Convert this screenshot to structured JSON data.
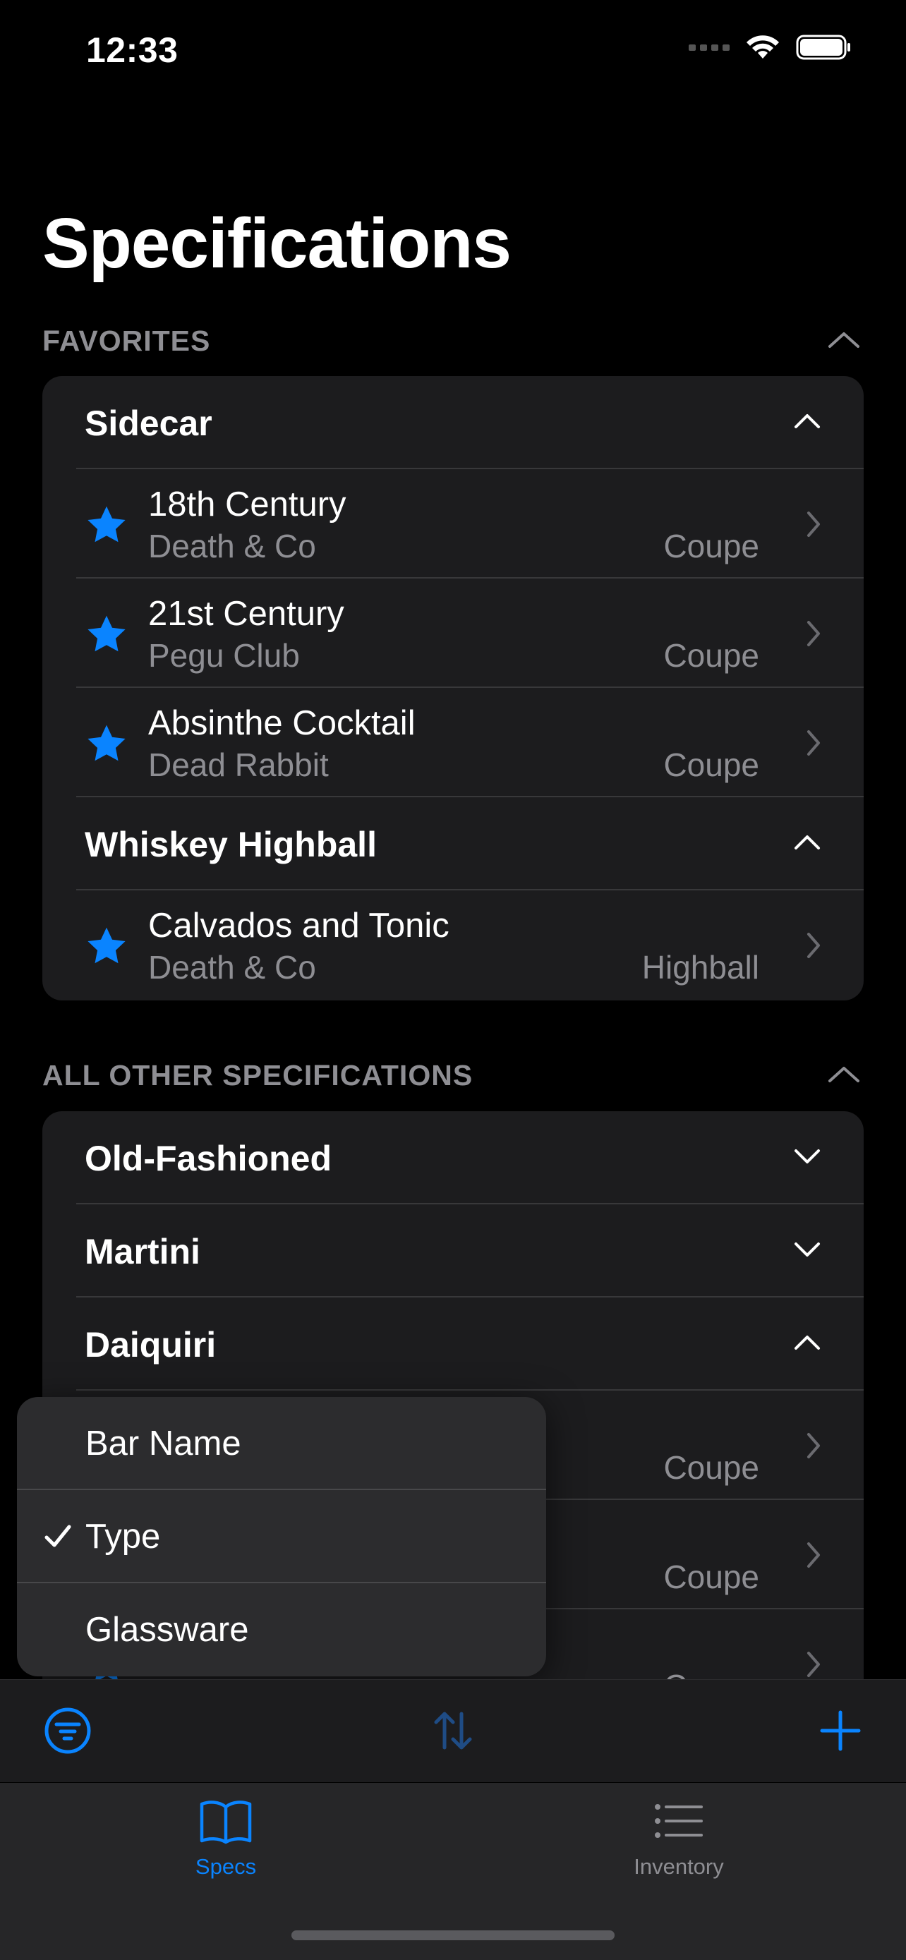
{
  "status_bar": {
    "time": "12:33"
  },
  "page_title": "Specifications",
  "colors": {
    "accent": "#0a84ff",
    "secondary_text": "#8e8e93",
    "card_bg": "#1c1c1e"
  },
  "favorites": {
    "header": "FAVORITES",
    "groups": [
      {
        "name": "Sidecar",
        "items": [
          {
            "name": "18th Century",
            "bar": "Death & Co",
            "glass": "Coupe"
          },
          {
            "name": "21st Century",
            "bar": "Pegu Club",
            "glass": "Coupe"
          },
          {
            "name": "Absinthe Cocktail",
            "bar": "Dead Rabbit",
            "glass": "Coupe"
          }
        ]
      },
      {
        "name": "Whiskey Highball",
        "items": [
          {
            "name": "Calvados and Tonic",
            "bar": "Death & Co",
            "glass": "Highball"
          }
        ]
      }
    ]
  },
  "others": {
    "header": "ALL OTHER SPECIFICATIONS",
    "groups": [
      "Old-Fashioned",
      "Martini",
      "Daiquiri"
    ],
    "visible_rows": [
      {
        "glass": "Coupe"
      },
      {
        "glass": "Coupe"
      },
      {
        "glass": "Coupe"
      }
    ]
  },
  "sort_menu": {
    "options": [
      "Bar Name",
      "Type",
      "Glassware"
    ],
    "selected": "Type"
  },
  "tabs": [
    {
      "label": "Specs",
      "icon": "book-icon",
      "active": true
    },
    {
      "label": "Inventory",
      "icon": "list-icon",
      "active": false
    }
  ]
}
